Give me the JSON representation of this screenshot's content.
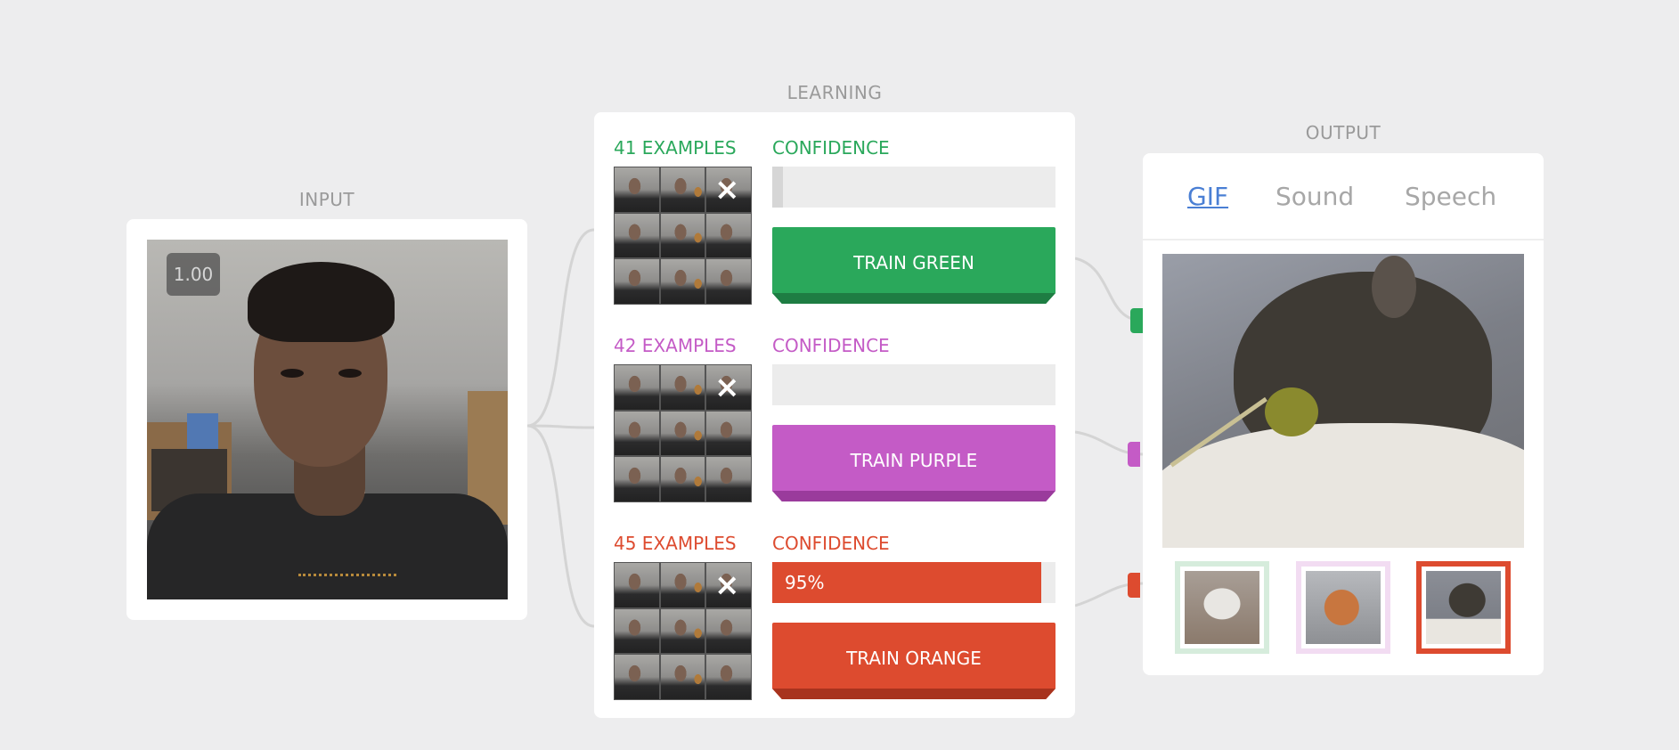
{
  "sections": {
    "input": "INPUT",
    "learning": "LEARNING",
    "output": "OUTPUT"
  },
  "input": {
    "score": "1.00"
  },
  "classes": [
    {
      "examples_label": "41 EXAMPLES",
      "confidence_label": "CONFIDENCE",
      "confidence_value": "",
      "confidence_fraction": 0.0,
      "train_label": "TRAIN GREEN",
      "color": "#2aa85b",
      "shade": "#1e7d43"
    },
    {
      "examples_label": "42 EXAMPLES",
      "confidence_label": "CONFIDENCE",
      "confidence_value": "",
      "confidence_fraction": 0.0,
      "train_label": "TRAIN PURPLE",
      "color": "#c45bc6",
      "shade": "#9a3b9c"
    },
    {
      "examples_label": "45 EXAMPLES",
      "confidence_label": "CONFIDENCE",
      "confidence_value": "95%",
      "confidence_fraction": 0.95,
      "train_label": "TRAIN ORANGE",
      "color": "#dd4b2f",
      "shade": "#a8331e"
    }
  ],
  "output": {
    "tabs": [
      {
        "label": "GIF",
        "active": true
      },
      {
        "label": "Sound",
        "active": false
      },
      {
        "label": "Speech",
        "active": false
      }
    ],
    "thumbnails": [
      {
        "class": "green",
        "border": "#d6ecdc"
      },
      {
        "class": "purple",
        "border": "#f2dcf2"
      },
      {
        "class": "orange",
        "border": "#dd4b2f"
      }
    ]
  },
  "icons": {
    "clear": "×"
  }
}
